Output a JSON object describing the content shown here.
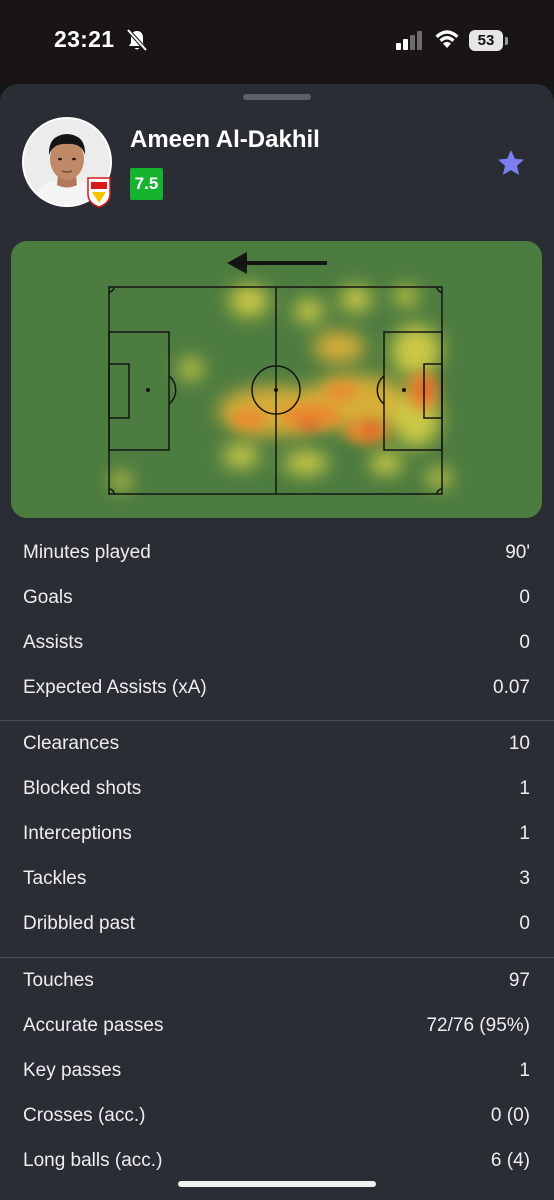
{
  "status_bar": {
    "time": "23:21",
    "battery": "53"
  },
  "player": {
    "name": "Ameen Al-Dakhil",
    "rating": "7.5",
    "rating_color": "#16b331",
    "favorite_color": "#7b7ff0"
  },
  "heatmap": {
    "attack_direction": "left",
    "pitch_color": "#4d7c40"
  },
  "stats": {
    "general": [
      {
        "label": "Minutes played",
        "value": "90'"
      },
      {
        "label": "Goals",
        "value": "0"
      },
      {
        "label": "Assists",
        "value": "0"
      },
      {
        "label": "Expected Assists (xA)",
        "value": "0.07"
      }
    ],
    "defending": [
      {
        "label": "Clearances",
        "value": "10"
      },
      {
        "label": "Blocked shots",
        "value": "1"
      },
      {
        "label": "Interceptions",
        "value": "1"
      },
      {
        "label": "Tackles",
        "value": "3"
      },
      {
        "label": "Dribbled past",
        "value": "0"
      }
    ],
    "passing": [
      {
        "label": "Touches",
        "value": "97"
      },
      {
        "label": "Accurate passes",
        "value": "72/76 (95%)"
      },
      {
        "label": "Key passes",
        "value": "1"
      },
      {
        "label": "Crosses (acc.)",
        "value": "0 (0)"
      },
      {
        "label": "Long balls (acc.)",
        "value": "6 (4)"
      }
    ]
  }
}
